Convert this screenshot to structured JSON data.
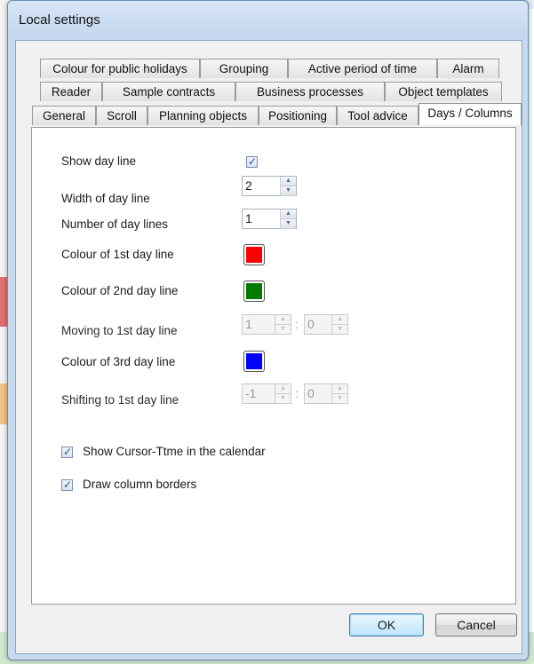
{
  "window": {
    "title": "Local settings"
  },
  "tabs": {
    "row1": [
      "Colour for public holidays",
      "Grouping",
      "Active period of time",
      "Alarm"
    ],
    "row2": [
      "Reader",
      "Sample contracts",
      "Business processes",
      "Object templates"
    ],
    "row3": [
      "General",
      "Scroll",
      "Planning objects",
      "Positioning",
      "Tool advice",
      "Days / Columns"
    ],
    "active": "Days / Columns"
  },
  "settings": {
    "show_day_line": {
      "label": "Show day line",
      "checked": true
    },
    "width_of_day_line": {
      "label": "Width of day line",
      "value": "2"
    },
    "number_of_day_lines": {
      "label": "Number of day lines",
      "value": "1"
    },
    "colour_1st": {
      "label": "Colour of 1st day line",
      "color": "#ff0000"
    },
    "colour_2nd": {
      "label": "Colour of 2nd day line",
      "color": "#007a00"
    },
    "moving_1st": {
      "label": "Moving to 1st day line",
      "hours": "1",
      "minutes": "0",
      "separator": ":"
    },
    "colour_3rd": {
      "label": "Colour of 3rd day line",
      "color": "#0000ff"
    },
    "shifting_1st": {
      "label": "Shifting to 1st day line",
      "hours": "-1",
      "minutes": "0",
      "separator": ":"
    },
    "show_cursor_time": {
      "label": "Show Cursor-Ttme in the calendar",
      "checked": true
    },
    "draw_column_borders": {
      "label": "Draw column borders",
      "checked": true
    }
  },
  "buttons": {
    "ok": "OK",
    "cancel": "Cancel"
  }
}
